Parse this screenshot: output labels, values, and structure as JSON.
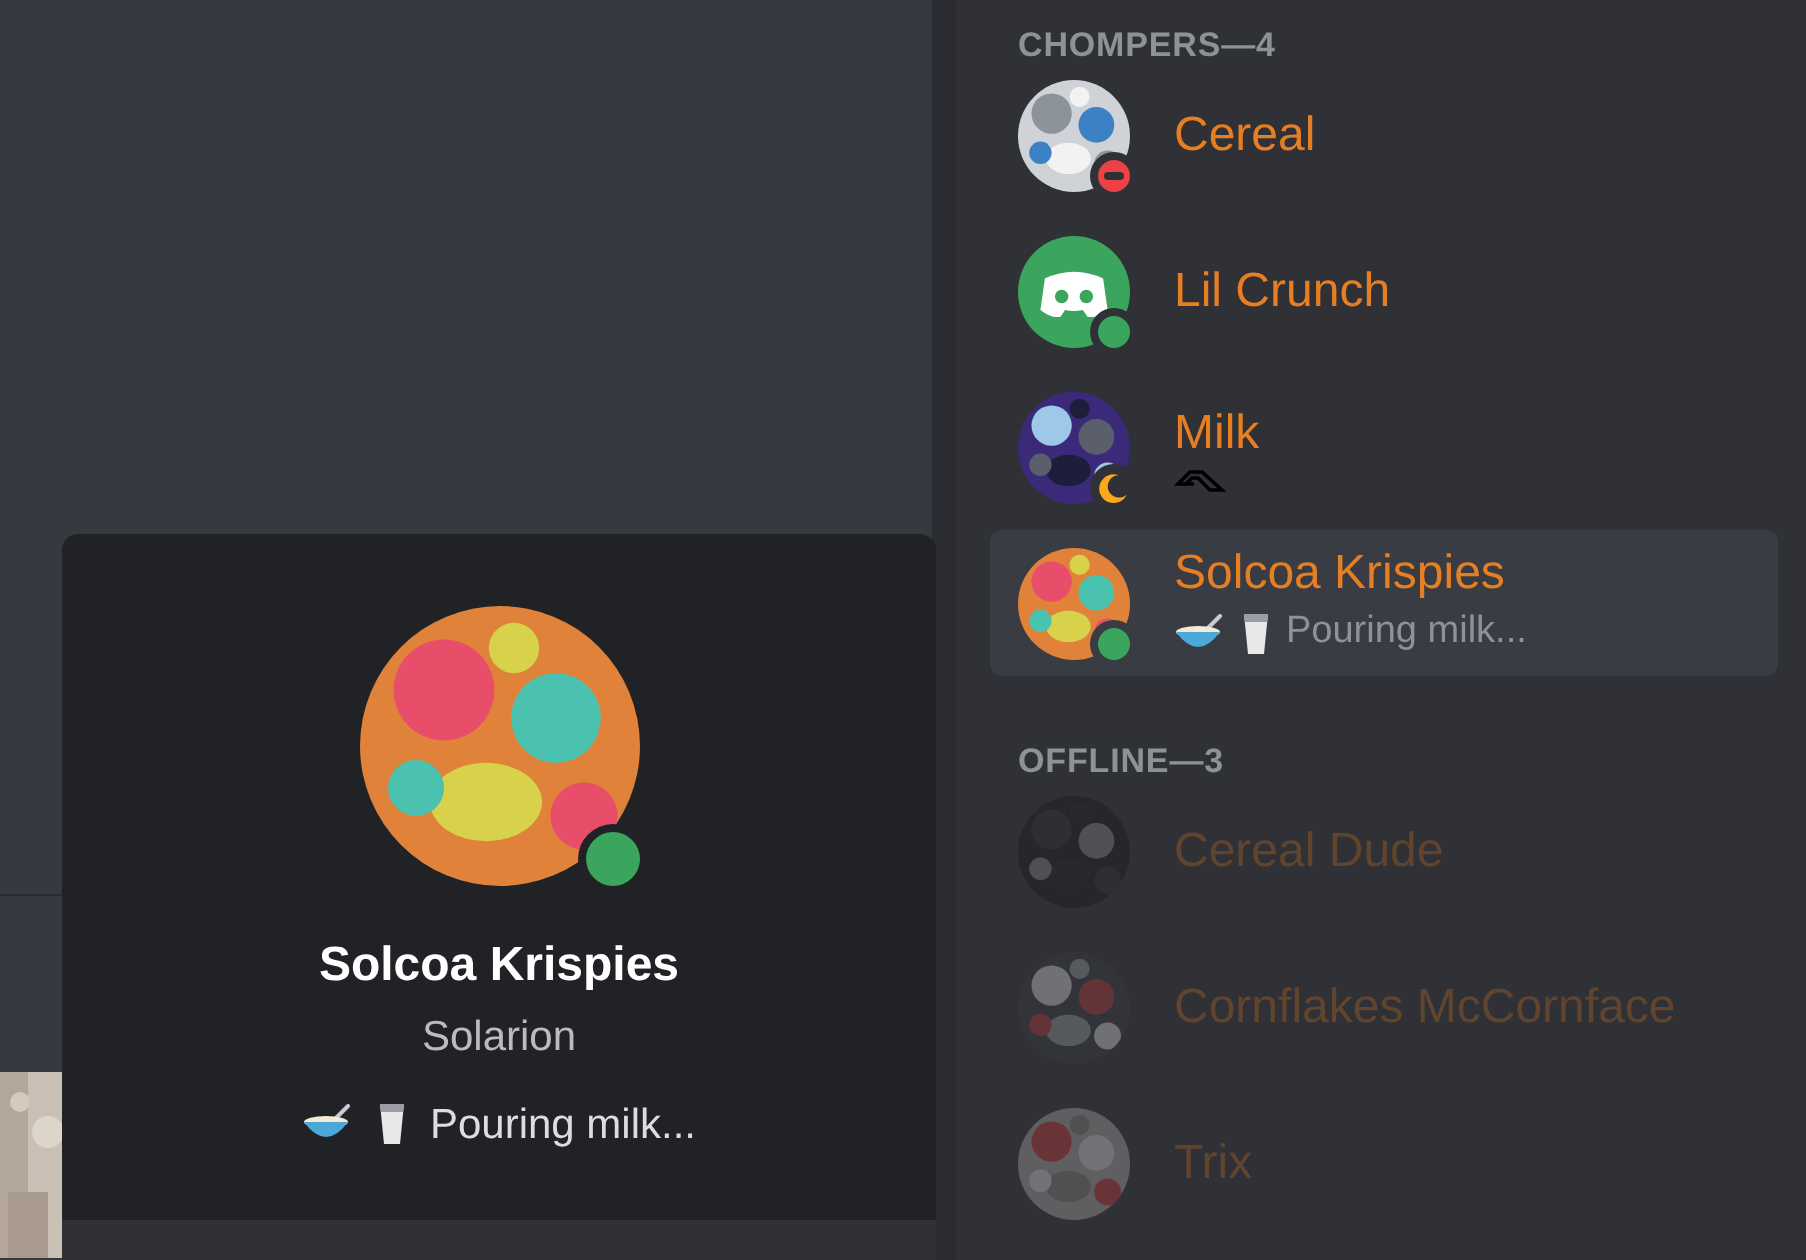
{
  "sections": [
    {
      "title": "CHOMPERS—4",
      "offline": false,
      "members": [
        {
          "name": "Cereal",
          "kind": "picture",
          "status": {
            "kind": "dnd",
            "color": "#ed4245"
          },
          "selected": false
        },
        {
          "name": "Lil Crunch",
          "kind": "default",
          "status": {
            "kind": "dot",
            "color": "#3ba55d"
          },
          "selected": false
        },
        {
          "name": "Milk",
          "kind": "picture",
          "status": {
            "kind": "moon",
            "color": "#faa81a"
          },
          "selected": false,
          "activity_icon": true
        },
        {
          "name": "Solcoa Krispies",
          "kind": "picture",
          "status": {
            "kind": "dot",
            "color": "#3ba55d"
          },
          "selected": true,
          "custom_status": "Pouring milk..."
        }
      ]
    },
    {
      "title": "OFFLINE—3",
      "offline": true,
      "members": [
        {
          "name": "Cereal Dude",
          "kind": "picture",
          "selected": false
        },
        {
          "name": "Cornflakes McCornface",
          "kind": "picture",
          "selected": false
        },
        {
          "name": "Trix",
          "kind": "picture",
          "selected": false
        }
      ]
    }
  ],
  "popout": {
    "name": "Solcoa Krispies",
    "username": "Solarion",
    "status": {
      "kind": "dot",
      "color": "#3ba55d"
    },
    "custom_status": "Pouring milk..."
  }
}
